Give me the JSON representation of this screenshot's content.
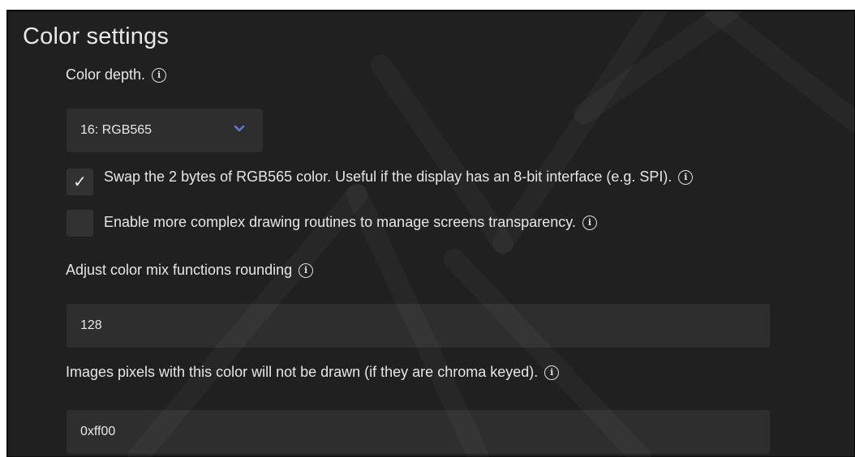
{
  "section": {
    "title": "Color settings"
  },
  "color_depth": {
    "label": "Color depth.",
    "selected": "16: RGB565"
  },
  "swap_bytes": {
    "label": "Swap the 2 bytes of RGB565 color. Useful if the display has an 8-bit interface (e.g. SPI).",
    "checked": true,
    "check_glyph": "✓"
  },
  "screen_transp": {
    "label": "Enable more complex drawing routines to manage screens transparency.",
    "checked": false
  },
  "color_mix_rounding": {
    "label": "Adjust color mix functions rounding",
    "value": "128"
  },
  "chroma_key": {
    "label": "Images pixels with this color will not be drawn (if they are chroma keyed).",
    "value": "0xff00"
  },
  "icons": {
    "info": "info-icon",
    "dropdown": "chevron-down-icon",
    "check": "checkmark-icon"
  },
  "colors": {
    "panel_bg": "#202020",
    "control_bg": "#2e2e2e",
    "text": "#e6e6e6",
    "accent": "#6b74d6"
  }
}
